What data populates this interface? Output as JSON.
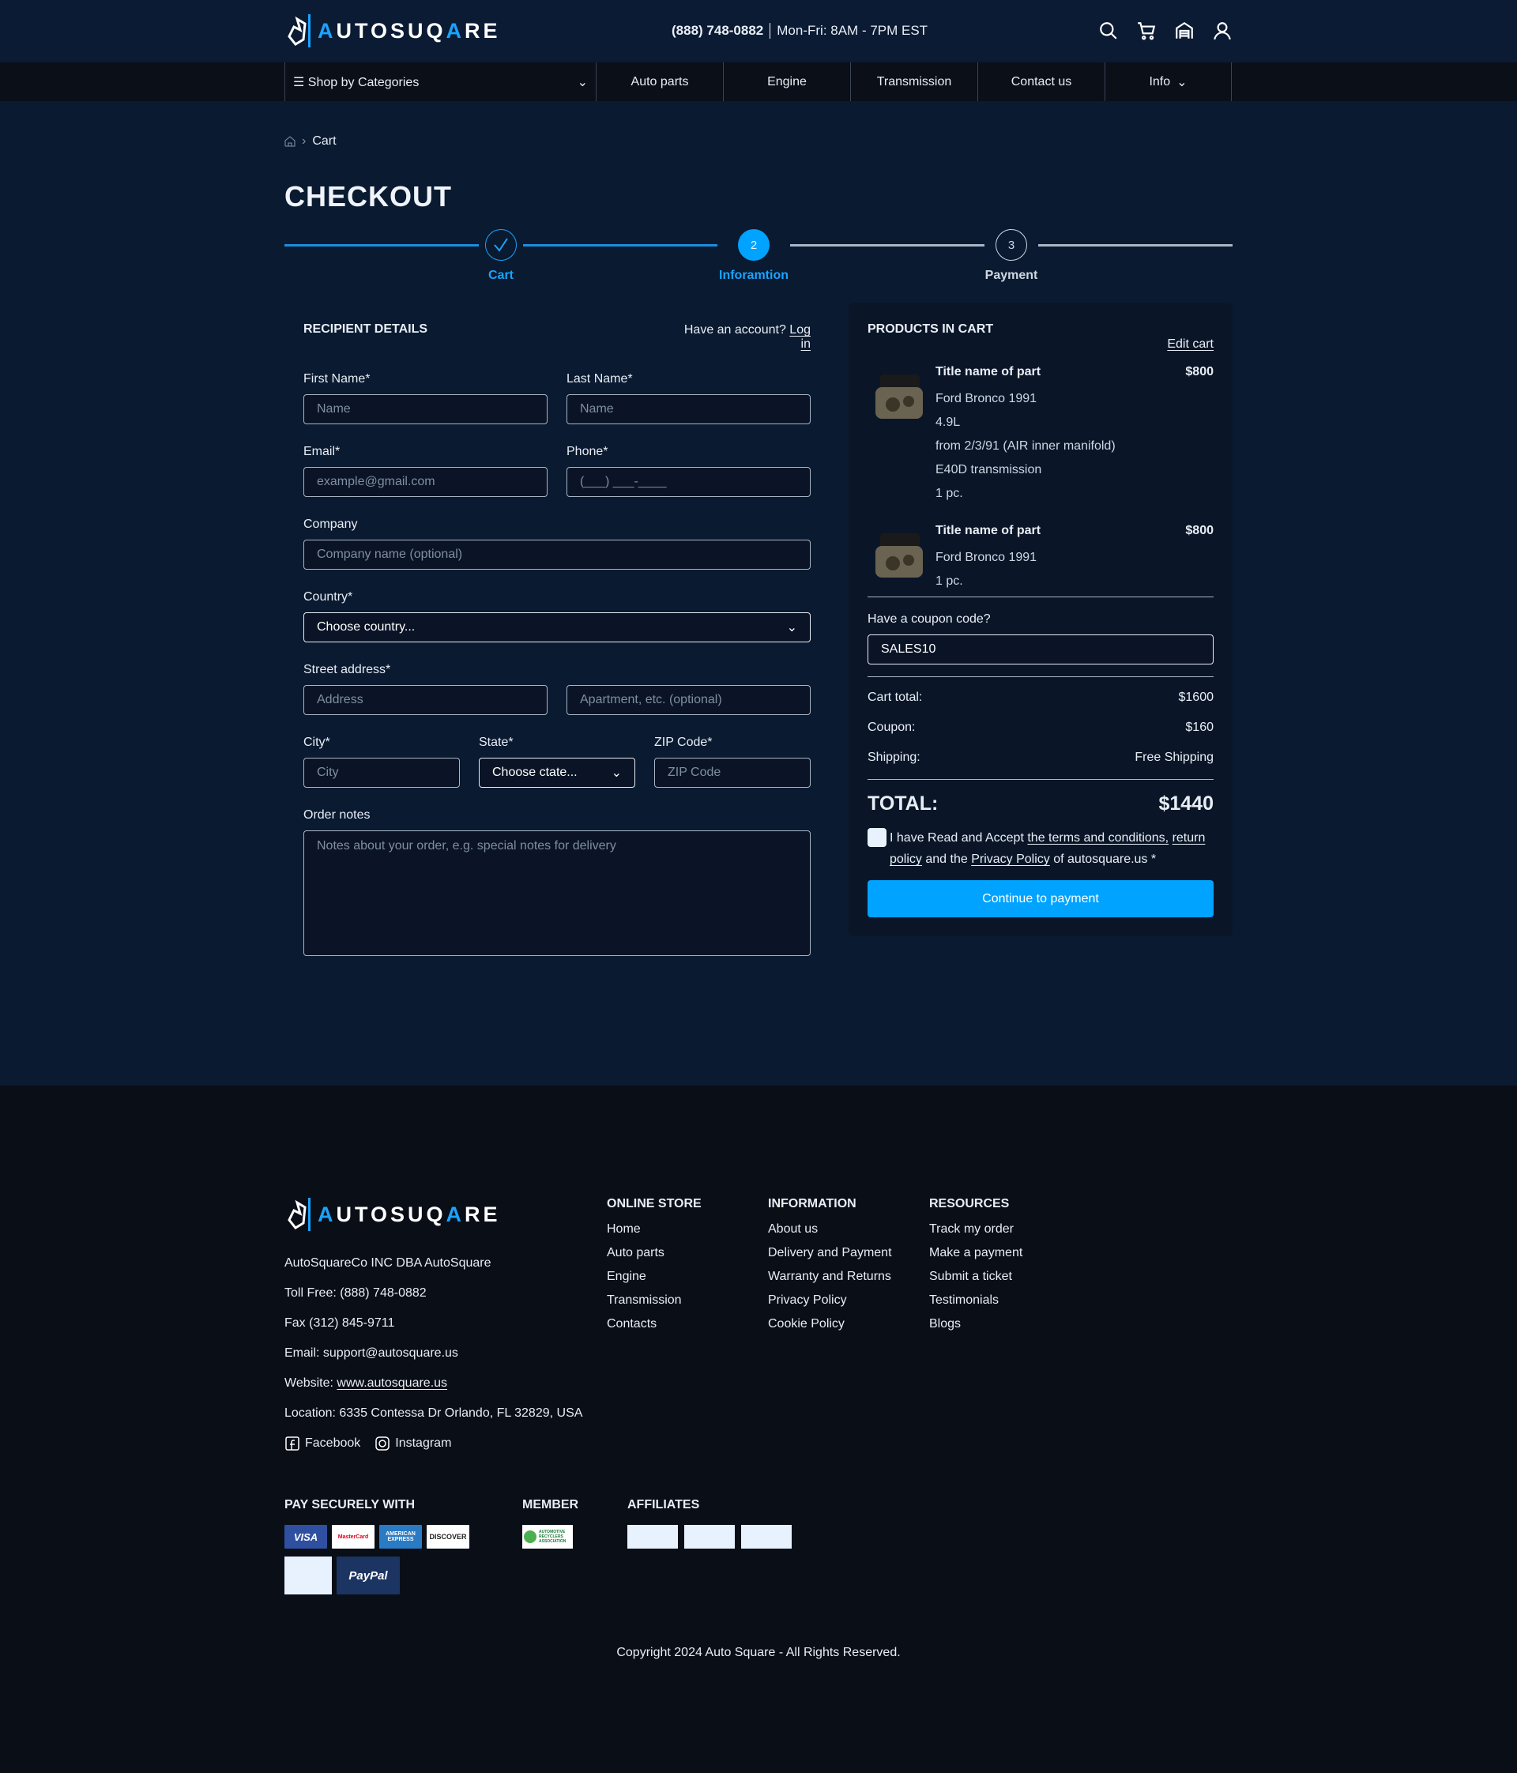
{
  "header": {
    "brand": "AUTOSQUARE",
    "brand_a": "A",
    "brand_b": "UTOSUQ",
    "brand_c": "A",
    "brand_d": "RE",
    "phone": "(888) 748-0882",
    "hours": "Mon-Fri: 8AM - 7PM EST"
  },
  "nav": {
    "categories": "Shop by Categories",
    "items": [
      "Auto parts",
      "Engine",
      "Transmission",
      "Contact us",
      "Info"
    ]
  },
  "breadcrumb": {
    "current": "Cart"
  },
  "page_title": "CHECKOUT",
  "steps": [
    {
      "label": "Cart",
      "state": "done"
    },
    {
      "label": "Inforamtion",
      "number": "2",
      "state": "active"
    },
    {
      "label": "Payment",
      "number": "3",
      "state": "pending"
    }
  ],
  "form": {
    "title": "RECIPIENT DETAILS",
    "account_text": "Have an account?",
    "login": "Log in",
    "first_name": {
      "label": "First Name*",
      "placeholder": "Name"
    },
    "last_name": {
      "label": "Last Name*",
      "placeholder": "Name"
    },
    "email": {
      "label": "Email*",
      "placeholder": "example@gmail.com"
    },
    "phone": {
      "label": "Phone*",
      "placeholder": "(___) ___-____"
    },
    "company": {
      "label": "Company",
      "placeholder": "Company name (optional)"
    },
    "country": {
      "label": "Country*",
      "value": "Choose country..."
    },
    "street": {
      "label": "Street address*",
      "placeholder": "Address",
      "placeholder2": "Apartment, etc. (optional)"
    },
    "city": {
      "label": "City*",
      "placeholder": "City"
    },
    "state": {
      "label": "State*",
      "value": "Choose ctate..."
    },
    "zip": {
      "label": "ZIP Code*",
      "placeholder": "ZIP Code"
    },
    "notes": {
      "label": "Order notes",
      "placeholder": "Notes about your order, e.g. special notes for delivery"
    }
  },
  "cart": {
    "title": "PRODUCTS IN CART",
    "edit": "Edit cart",
    "items": [
      {
        "title": "Title name of part",
        "price": "$800",
        "lines": [
          "Ford Bronco 1991",
          "4.9L",
          "from 2/3/91 (AIR inner manifold)",
          "E40D transmission",
          "1 pc."
        ]
      },
      {
        "title": "Title name of part",
        "price": "$800",
        "lines": [
          "Ford Bronco 1991",
          "1 pc."
        ]
      }
    ],
    "coupon_label": "Have a coupon code?",
    "coupon_value": "SALES10",
    "cart_total_label": "Cart total:",
    "cart_total": "$1600",
    "coupon_row_label": "Coupon:",
    "coupon_amount": "$160",
    "shipping_label": "Shipping:",
    "shipping": "Free Shipping",
    "total_label": "TOTAL:",
    "total": "$1440",
    "terms": {
      "t1": "I have Read and Accept",
      "link1": "the terms and conditions,",
      "link2": "return policy",
      "t2": "and the",
      "link3": "Privacy Policy",
      "t3": "of autosquare.us *"
    },
    "continue": "Continue to payment"
  },
  "footer": {
    "company": "AutoSquareCo INC DBA AutoSquare",
    "toll": "Toll Free: (888) 748-0882",
    "fax": "Fax (312) 845-9711",
    "email": "Email: support@autosquare.us",
    "website_label": "Website:",
    "website": "www.autosquare.us",
    "location": "Location: 6335 Contessa Dr Orlando, FL 32829, USA",
    "facebook": "Facebook",
    "instagram": "Instagram",
    "columns": [
      {
        "title": "ONLINE STORE",
        "links": [
          "Home",
          "Auto parts",
          "Engine",
          "Transmission",
          "Contacts"
        ]
      },
      {
        "title": "INFORMATION",
        "links": [
          "About us",
          "Delivery and Payment",
          "Warranty and Returns",
          "Privacy Policy",
          "Cookie Policy"
        ]
      },
      {
        "title": "RESOURCES",
        "links": [
          "Track my order",
          "Make a payment",
          "Submit a ticket",
          "Testimonials",
          "Blogs"
        ]
      }
    ],
    "pay_title": "PAY SECURELY WITH",
    "member_title": "MEMBER",
    "affiliates_title": "AFFILIATES",
    "cards": [
      "VISA",
      "MasterCard",
      "AMERICAN EXPRESS",
      "DISCOVER",
      "PayPal"
    ],
    "member_logo": "AUTOMOTIVE RECYCLERS ASSOCIATION",
    "copyright": "Copyright 2024 Auto Square - All Rights Reserved."
  },
  "colors": {
    "accent": "#00a3ff",
    "bg": "#0a1a30",
    "footer": "#0a0e17"
  }
}
